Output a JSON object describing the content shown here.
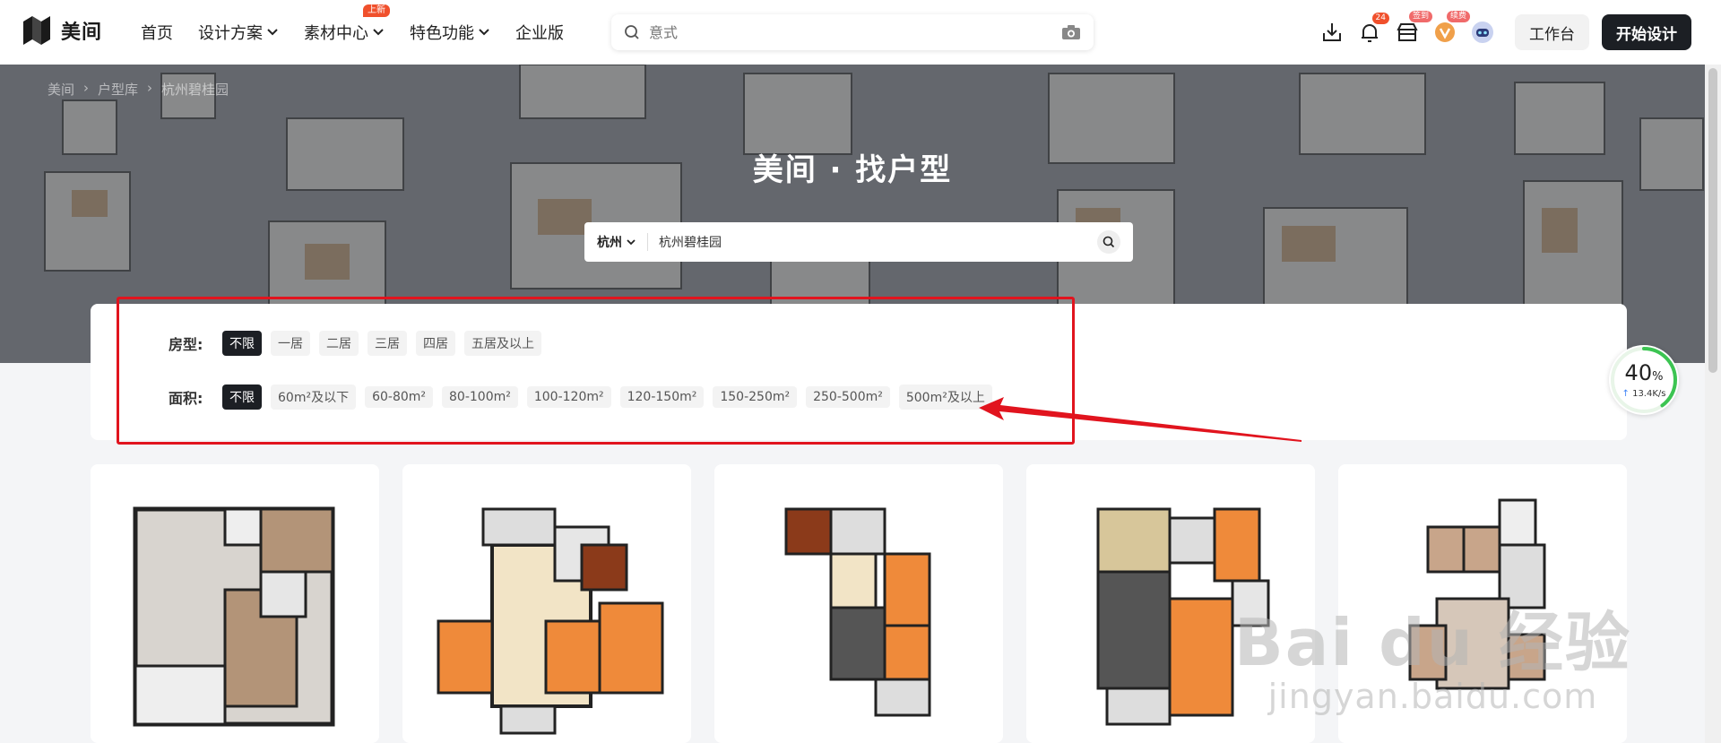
{
  "brand": {
    "name": "美间"
  },
  "nav": {
    "items": [
      {
        "label": "首页",
        "has_dropdown": false
      },
      {
        "label": "设计方案",
        "has_dropdown": true
      },
      {
        "label": "素材中心",
        "has_dropdown": true,
        "badge": "上新"
      },
      {
        "label": "特色功能",
        "has_dropdown": true
      },
      {
        "label": "企业版",
        "has_dropdown": false
      }
    ],
    "search_placeholder": "意式",
    "notification_count": "24",
    "signin_tag": "签到",
    "renew_tag": "续费",
    "workbench_label": "工作台",
    "start_design_label": "开始设计"
  },
  "breadcrumb": [
    "美间",
    "户型库",
    "杭州碧桂园"
  ],
  "hero": {
    "title": "美间 · 找户型",
    "city": "杭州",
    "query": "杭州碧桂园"
  },
  "filters": {
    "room_label": "房型:",
    "room_options": [
      "不限",
      "一居",
      "二居",
      "三居",
      "四居",
      "五居及以上"
    ],
    "room_selected": 0,
    "area_label": "面积:",
    "area_options": [
      "不限",
      "60m²及以下",
      "60-80m²",
      "80-100m²",
      "100-120m²",
      "120-150m²",
      "150-250m²",
      "250-500m²",
      "500m²及以上"
    ],
    "area_selected": 0
  },
  "speed_widget": {
    "percent": "40",
    "percent_unit": "%",
    "speed": "13.4K/s",
    "progress": 0.4
  },
  "watermark": {
    "line1": "Bai du 经验",
    "line2": "jingyan.baidu.com"
  },
  "colors": {
    "accent_dark": "#1c1f24",
    "annotation_red": "#e1141e",
    "badge_orange": "#f0502c"
  }
}
